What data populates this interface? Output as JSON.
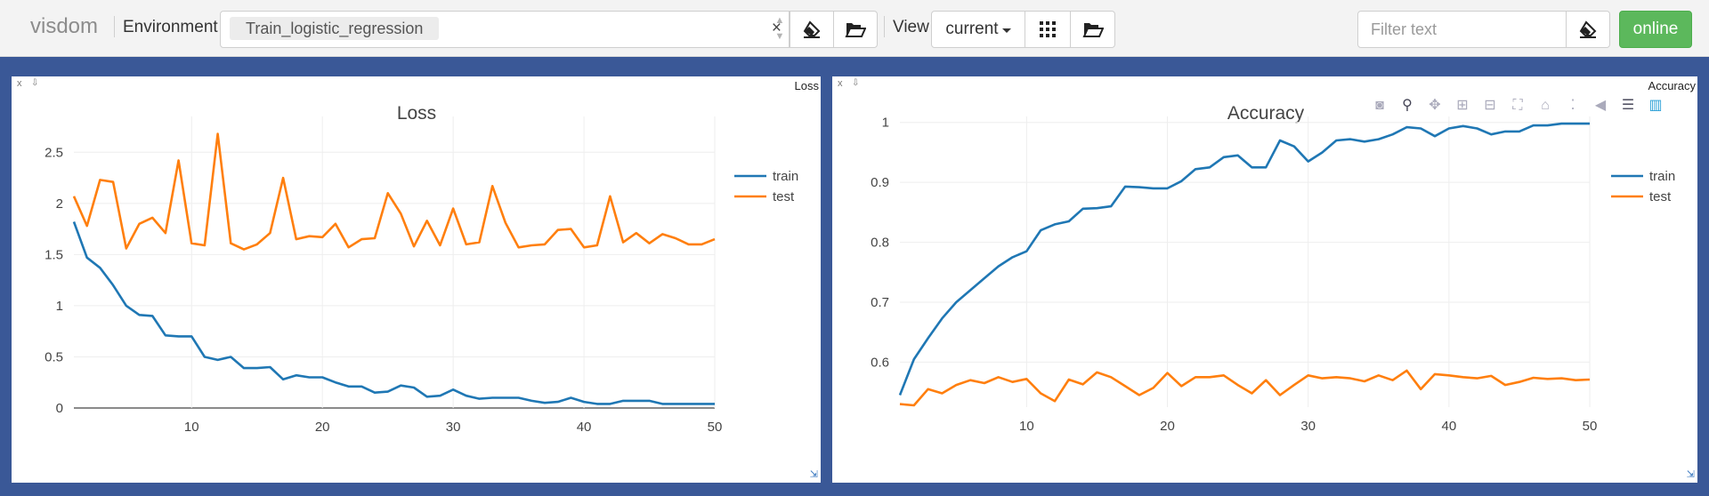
{
  "topbar": {
    "logo": "visdom",
    "environment_label": "Environment",
    "environment_value": "Train_logistic_regression",
    "clear_glyph": "×",
    "view_label": "View",
    "view_value": "current",
    "filter_placeholder": "Filter text",
    "status": "online"
  },
  "icons": {
    "clear_env": "eraser-icon",
    "open_env": "folder-open-icon",
    "grid": "grid-icon",
    "open_view": "folder-open-icon",
    "clear_filter": "eraser-icon"
  },
  "colors": {
    "train": "#1f77b4",
    "test": "#ff7f0e",
    "online": "#5cb85c",
    "background": "#3a5897"
  },
  "panes": [
    {
      "label": "Loss",
      "close": "x",
      "download": "⇩"
    },
    {
      "label": "Accuracy",
      "close": "x",
      "download": "⇩"
    }
  ],
  "chart_data": [
    {
      "type": "line",
      "title": "Loss",
      "x": [
        1,
        2,
        3,
        4,
        5,
        6,
        7,
        8,
        9,
        10,
        11,
        12,
        13,
        14,
        15,
        16,
        17,
        18,
        19,
        20,
        21,
        22,
        23,
        24,
        25,
        26,
        27,
        28,
        29,
        30,
        31,
        32,
        33,
        34,
        35,
        36,
        37,
        38,
        39,
        40,
        41,
        42,
        43,
        44,
        45,
        46,
        47,
        48,
        49,
        50
      ],
      "xticks": [
        10,
        20,
        30,
        40,
        50
      ],
      "yticks": [
        0,
        0.5,
        1,
        1.5,
        2,
        2.5
      ],
      "xlim": [
        1,
        50
      ],
      "ylim": [
        0,
        2.85
      ],
      "legend": "top-right",
      "grid": true,
      "series": [
        {
          "name": "train",
          "values": [
            1.82,
            1.47,
            1.37,
            1.2,
            1.0,
            0.91,
            0.9,
            0.71,
            0.7,
            0.7,
            0.5,
            0.47,
            0.5,
            0.39,
            0.39,
            0.4,
            0.28,
            0.32,
            0.3,
            0.3,
            0.25,
            0.21,
            0.21,
            0.15,
            0.16,
            0.22,
            0.2,
            0.11,
            0.12,
            0.18,
            0.12,
            0.09,
            0.1,
            0.1,
            0.1,
            0.07,
            0.05,
            0.06,
            0.1,
            0.06,
            0.04,
            0.04,
            0.07,
            0.07,
            0.07,
            0.04,
            0.04,
            0.04,
            0.04,
            0.04
          ]
        },
        {
          "name": "test",
          "values": [
            2.07,
            1.78,
            2.23,
            2.21,
            1.56,
            1.8,
            1.86,
            1.71,
            2.42,
            1.61,
            1.59,
            2.68,
            1.61,
            1.55,
            1.6,
            1.71,
            2.25,
            1.65,
            1.68,
            1.67,
            1.8,
            1.57,
            1.65,
            1.66,
            2.1,
            1.9,
            1.58,
            1.83,
            1.59,
            1.95,
            1.6,
            1.62,
            2.17,
            1.81,
            1.57,
            1.59,
            1.6,
            1.74,
            1.75,
            1.57,
            1.59,
            2.07,
            1.62,
            1.71,
            1.61,
            1.7,
            1.66,
            1.6,
            1.6,
            1.65
          ]
        }
      ]
    },
    {
      "type": "line",
      "title": "Accuracy",
      "x": [
        1,
        2,
        3,
        4,
        5,
        6,
        7,
        8,
        9,
        10,
        11,
        12,
        13,
        14,
        15,
        16,
        17,
        18,
        19,
        20,
        21,
        22,
        23,
        24,
        25,
        26,
        27,
        28,
        29,
        30,
        31,
        32,
        33,
        34,
        35,
        36,
        37,
        38,
        39,
        40,
        41,
        42,
        43,
        44,
        45,
        46,
        47,
        48,
        49,
        50
      ],
      "xticks": [
        10,
        20,
        30,
        40,
        50
      ],
      "yticks": [
        0.6,
        0.7,
        0.8,
        0.9,
        1
      ],
      "xlim": [
        1,
        50
      ],
      "ylim": [
        0.525,
        1.01
      ],
      "legend": "top-right",
      "grid": true,
      "series": [
        {
          "name": "train",
          "values": [
            0.545,
            0.605,
            0.64,
            0.673,
            0.7,
            0.72,
            0.74,
            0.76,
            0.775,
            0.785,
            0.82,
            0.83,
            0.835,
            0.856,
            0.857,
            0.86,
            0.893,
            0.892,
            0.89,
            0.89,
            0.902,
            0.922,
            0.925,
            0.942,
            0.945,
            0.925,
            0.925,
            0.97,
            0.96,
            0.935,
            0.95,
            0.97,
            0.972,
            0.968,
            0.972,
            0.98,
            0.992,
            0.99,
            0.977,
            0.99,
            0.994,
            0.99,
            0.98,
            0.985,
            0.985,
            0.995,
            0.995,
            0.998,
            0.998,
            0.998
          ]
        },
        {
          "name": "test",
          "values": [
            0.53,
            0.528,
            0.555,
            0.548,
            0.562,
            0.57,
            0.565,
            0.575,
            0.567,
            0.572,
            0.548,
            0.535,
            0.571,
            0.563,
            0.583,
            0.575,
            0.56,
            0.545,
            0.557,
            0.582,
            0.56,
            0.575,
            0.575,
            0.578,
            0.562,
            0.548,
            0.57,
            0.545,
            0.562,
            0.578,
            0.573,
            0.575,
            0.573,
            0.568,
            0.578,
            0.57,
            0.586,
            0.555,
            0.58,
            0.578,
            0.575,
            0.573,
            0.577,
            0.562,
            0.567,
            0.574,
            0.572,
            0.573,
            0.57,
            0.571
          ]
        }
      ]
    }
  ]
}
